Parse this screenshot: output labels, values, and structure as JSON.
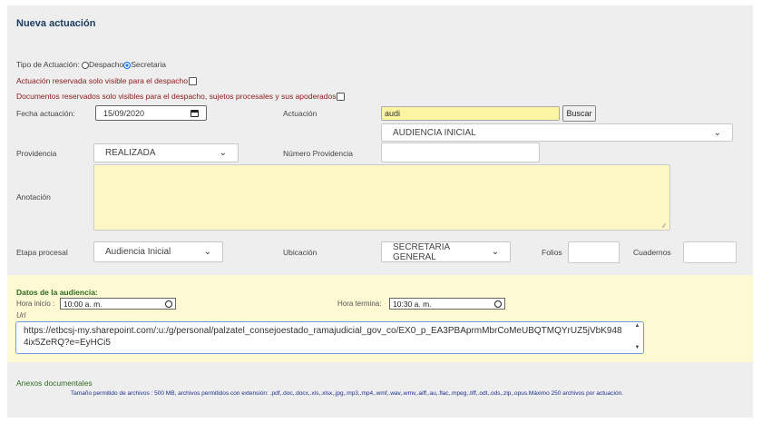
{
  "title": "Nueva actuación",
  "tipo": {
    "label": "Tipo de Actuación: ",
    "opt1": "Despacho",
    "opt2": "Secretaria"
  },
  "reserved1": "Actuación reservada solo visible para el despacho",
  "reserved2": "Documentos reservados solo visibles para el despacho, sujetos procesales y sus apoderados",
  "fecha": {
    "label": "Fecha actuación:",
    "value": "15/09/2020"
  },
  "actuacion": {
    "label": "Actuación",
    "search_value": "audi",
    "search_button": "Buscar",
    "result": "AUDIENCIA INICIAL"
  },
  "providencia": {
    "label": "Providencia",
    "value": "REALIZADA"
  },
  "numero_providencia": {
    "label": "Número Providencia",
    "value": ""
  },
  "anotacion": {
    "label": "Anotación",
    "value": ""
  },
  "etapa": {
    "label": "Etapa procesal",
    "value": "Audiencia Inicial"
  },
  "ubicacion": {
    "label": "Ubicación",
    "value": "SECRETARIA GENERAL"
  },
  "folios": {
    "label": "Folios",
    "value": ""
  },
  "cuadernos": {
    "label": "Cuadernos",
    "value": ""
  },
  "audiencia": {
    "header": "Datos de la audiencia:",
    "hora_inicio_label": "Hora inicio : ",
    "hora_inicio": "10:00 a. m.",
    "hora_termina_label": "Hora termina: ",
    "hora_termina": "10:30 a. m.",
    "url_label": "Url",
    "url_value": "https://etbcsj-my.sharepoint.com/:u:/g/personal/palzatel_consejoestado_ramajudicial_gov_co/EX0_p_EA3PBAprmMbrCoMeUBQTMQYrUZ5jVbK9484ix5ZeRQ?e=EyHCi5"
  },
  "anexos": {
    "label": "Anexos documentales",
    "note": "Tamaño permitido de archivos : 500 MB, archivos permitidos con extensión: .pdf,.doc,.docx,.xls,.xlsx,.jpg,.mp3,.mp4,.wmf,.wav,.wmv,.aiff,.au,.flac,.mpeg,.tiff,.odt,.ods,.zip,.opus.Máximo 250 archivos por actuación."
  }
}
